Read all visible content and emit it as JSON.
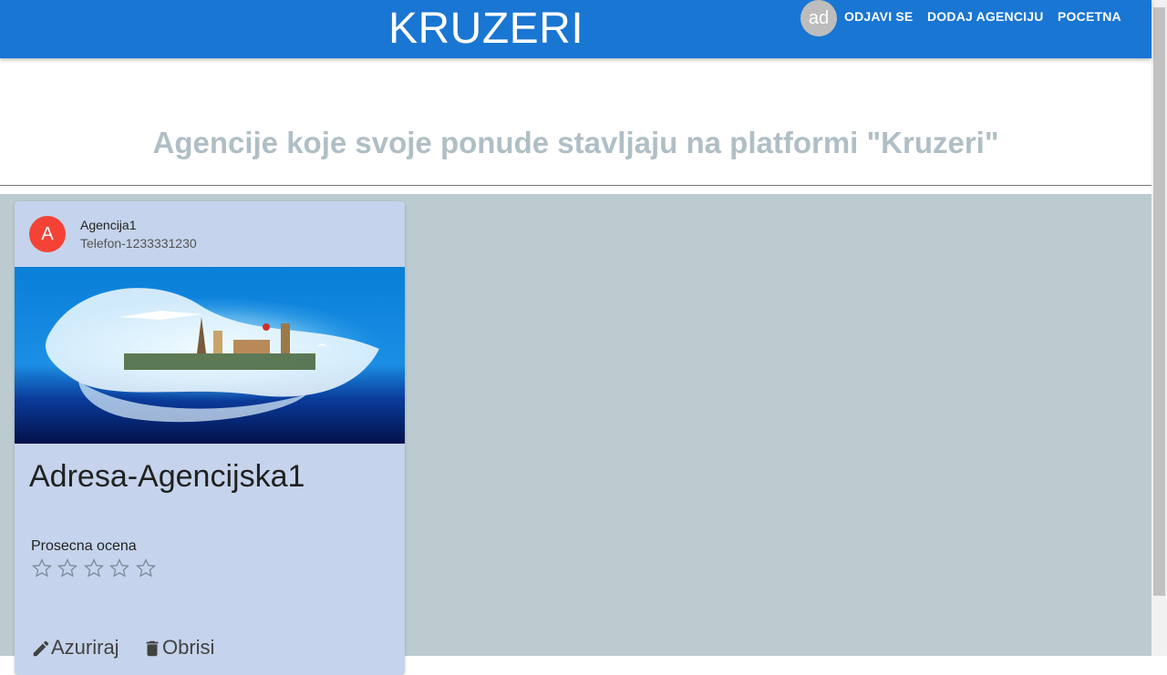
{
  "header": {
    "brand": "KRUZERI",
    "avatar_initials": "ad",
    "nav": [
      "ODJAVI SE",
      "DODAJ AGENCIJU",
      "POCETNA"
    ]
  },
  "page": {
    "heading": "Agencije koje svoje ponude stavljaju na platformi \"Kruzeri\""
  },
  "agencies": [
    {
      "avatar_letter": "A",
      "name": "Agencija1",
      "phone": "Telefon-1233331230",
      "address": "Adresa-Agencijska1",
      "rating_label": "Prosecna ocena",
      "rating": 0,
      "rating_max": 5,
      "actions": {
        "edit": "Azuriraj",
        "delete": "Obrisi"
      }
    }
  ],
  "colors": {
    "appbar": "#1976d2",
    "heading_text": "#b0bec5",
    "content_bg": "#bccbcf",
    "card_bg": "#c5d4ec",
    "agency_avatar": "#f44336"
  }
}
